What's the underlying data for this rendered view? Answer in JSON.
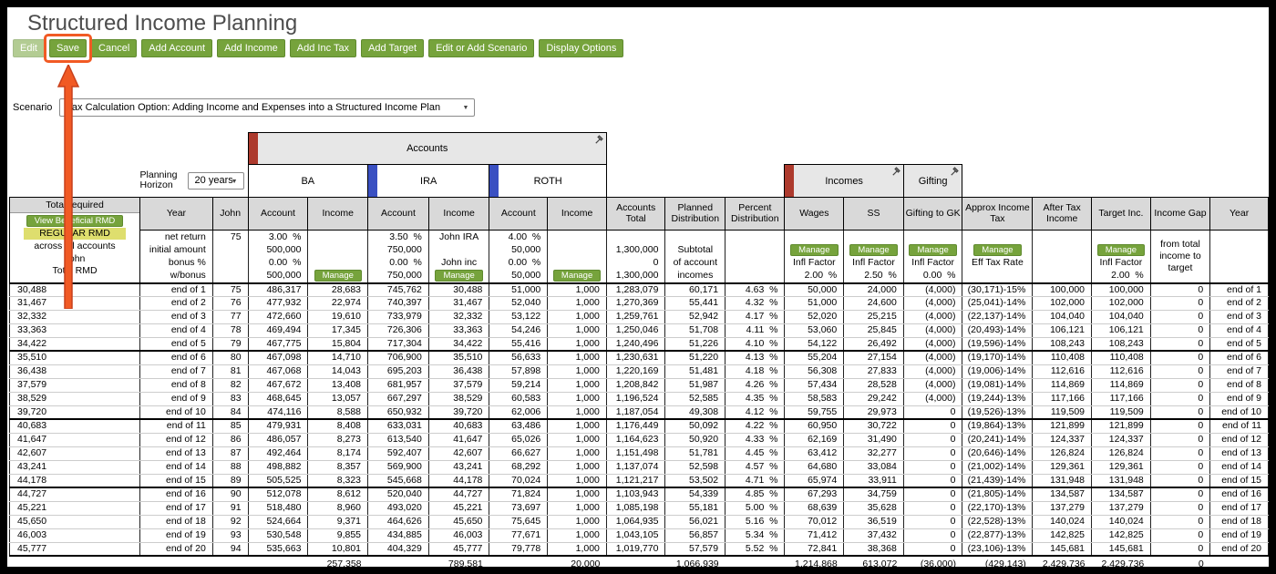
{
  "header": {
    "title": "Structured Income Planning",
    "toolbar": [
      {
        "id": "edit",
        "label": "Edit",
        "disabled": true
      },
      {
        "id": "save",
        "label": "Save",
        "annotated": true
      },
      {
        "id": "cancel",
        "label": "Cancel"
      },
      {
        "id": "add-account",
        "label": "Add Account"
      },
      {
        "id": "add-income",
        "label": "Add Income"
      },
      {
        "id": "add-inc-tax",
        "label": "Add Inc Tax"
      },
      {
        "id": "add-target",
        "label": "Add Target"
      },
      {
        "id": "edit-or-add-scenario",
        "label": "Edit or Add Scenario"
      },
      {
        "id": "display-options",
        "label": "Display Options"
      }
    ],
    "scenario_label": "Scenario",
    "scenario_value": "Tax Calculation Option: Adding Income and Expenses into a Structured Income Plan"
  },
  "icons": {
    "pin_icon": "pushpin",
    "dropdown_arrow_icon": "▼"
  },
  "colors": {
    "button_green": "#76a33c",
    "highlight_orange": "#f15a24",
    "header_gray": "#d9d9d9",
    "tab_red": "#ad3a2d",
    "tab_blue": "#3a50c2",
    "rmd_yellow": "#dede6e",
    "infl_peach": "#f5c48d"
  },
  "groups": {
    "accounts": "Accounts",
    "incomes": "Incomes",
    "gifting": "Gifting",
    "planning_horizon_label": "Planning Horizon",
    "planning_horizon_value": "20 years",
    "tabs": {
      "ba": "BA",
      "ira": "IRA",
      "roth": "ROTH"
    }
  },
  "left_panel": {
    "total_required": "Total required",
    "view_btn": "View Beneficial RMD",
    "regular_rmd": "REGULAR RMD",
    "across": "across all accounts",
    "owner": "John",
    "total_rmd": "Total RMD"
  },
  "table": {
    "headers": [
      "Year",
      "John",
      "Account",
      "Income",
      "Account",
      "Income",
      "Account",
      "Income",
      "Accounts Total",
      "Planned Distribution",
      "Percent Distribution",
      "Wages",
      "SS",
      "Gifting to GK",
      "Approx Income Tax",
      "After Tax Income",
      "Target Inc.",
      "Income Gap",
      "Year"
    ],
    "subrows": {
      "net_return_label": "net return",
      "start_age": "75",
      "ba_return": "3.00  %",
      "ira_return": "3.50  %",
      "ira_income_name": "John IRA",
      "roth_return": "4.00  %",
      "initial_label": "initial amount",
      "ba_initial": "500,000",
      "ira_initial": "750,000",
      "roth_initial": "50,000",
      "total_initial": "1,300,000",
      "subtotal_1": "Subtotal",
      "bonus_label": "bonus %",
      "ba_bonus": "0.00  %",
      "ira_bonus": "0.00  %",
      "ira_income_name2": "John inc",
      "roth_bonus": "0.00  %",
      "total_bonus": "0",
      "subtotal_2": "of account",
      "wbonus_label": "w/bonus",
      "ba_wbonus": "500,000",
      "ira_wbonus": "750,000",
      "roth_wbonus": "50,000",
      "total_wbonus": "1,300,000",
      "subtotal_3": "incomes",
      "manage_label": "Manage",
      "infl_label": "Infl Factor",
      "eff_label": "Eff Tax Rate",
      "wages_infl": "2.00  %",
      "ss_infl": "2.50  %",
      "gift_infl": "0.00  %",
      "target_infl": "2.00  %",
      "gap_note": "from total\nincome to\ntarget"
    },
    "rows": [
      [
        "30,488",
        "end of 1",
        "75",
        "486,317",
        "28,683",
        "745,762",
        "30,488",
        "51,000",
        "1,000",
        "1,283,079",
        "60,171",
        "4.63  %",
        "50,000",
        "24,000",
        "(4,000)",
        "(30,171)-15%",
        "100,000",
        "100,000",
        "0",
        "end of 1"
      ],
      [
        "31,467",
        "end of 2",
        "76",
        "477,932",
        "22,974",
        "740,397",
        "31,467",
        "52,040",
        "1,000",
        "1,270,369",
        "55,441",
        "4.32  %",
        "51,000",
        "24,600",
        "(4,000)",
        "(25,041)-14%",
        "102,000",
        "102,000",
        "0",
        "end of 2"
      ],
      [
        "32,332",
        "end of 3",
        "77",
        "472,660",
        "19,610",
        "733,979",
        "32,332",
        "53,122",
        "1,000",
        "1,259,761",
        "52,942",
        "4.17  %",
        "52,020",
        "25,215",
        "(4,000)",
        "(22,137)-14%",
        "104,040",
        "104,040",
        "0",
        "end of 3"
      ],
      [
        "33,363",
        "end of 4",
        "78",
        "469,494",
        "17,345",
        "726,306",
        "33,363",
        "54,246",
        "1,000",
        "1,250,046",
        "51,708",
        "4.11  %",
        "53,060",
        "25,845",
        "(4,000)",
        "(20,493)-14%",
        "106,121",
        "106,121",
        "0",
        "end of 4"
      ],
      [
        "34,422",
        "end of 5",
        "79",
        "467,775",
        "15,804",
        "717,304",
        "34,422",
        "55,416",
        "1,000",
        "1,240,496",
        "51,226",
        "4.10  %",
        "54,122",
        "26,492",
        "(4,000)",
        "(19,596)-14%",
        "108,243",
        "108,243",
        "0",
        "end of 5"
      ],
      [
        "35,510",
        "end of 6",
        "80",
        "467,098",
        "14,710",
        "706,900",
        "35,510",
        "56,633",
        "1,000",
        "1,230,631",
        "51,220",
        "4.13  %",
        "55,204",
        "27,154",
        "(4,000)",
        "(19,170)-14%",
        "110,408",
        "110,408",
        "0",
        "end of 6"
      ],
      [
        "36,438",
        "end of 7",
        "81",
        "467,068",
        "14,043",
        "695,203",
        "36,438",
        "57,898",
        "1,000",
        "1,220,169",
        "51,481",
        "4.18  %",
        "56,308",
        "27,833",
        "(4,000)",
        "(19,006)-14%",
        "112,616",
        "112,616",
        "0",
        "end of 7"
      ],
      [
        "37,579",
        "end of 8",
        "82",
        "467,672",
        "13,408",
        "681,957",
        "37,579",
        "59,214",
        "1,000",
        "1,208,842",
        "51,987",
        "4.26  %",
        "57,434",
        "28,528",
        "(4,000)",
        "(19,081)-14%",
        "114,869",
        "114,869",
        "0",
        "end of 8"
      ],
      [
        "38,529",
        "end of 9",
        "83",
        "468,645",
        "13,057",
        "667,297",
        "38,529",
        "60,583",
        "1,000",
        "1,196,524",
        "52,585",
        "4.35  %",
        "58,583",
        "29,242",
        "(4,000)",
        "(19,244)-13%",
        "117,166",
        "117,166",
        "0",
        "end of 9"
      ],
      [
        "39,720",
        "end of 10",
        "84",
        "474,116",
        "8,588",
        "650,932",
        "39,720",
        "62,006",
        "1,000",
        "1,187,054",
        "49,308",
        "4.12  %",
        "59,755",
        "29,973",
        "0",
        "(19,526)-13%",
        "119,509",
        "119,509",
        "0",
        "end of 10"
      ],
      [
        "40,683",
        "end of 11",
        "85",
        "479,931",
        "8,408",
        "633,031",
        "40,683",
        "63,486",
        "1,000",
        "1,176,449",
        "50,092",
        "4.22  %",
        "60,950",
        "30,722",
        "0",
        "(19,864)-13%",
        "121,899",
        "121,899",
        "0",
        "end of 11"
      ],
      [
        "41,647",
        "end of 12",
        "86",
        "486,057",
        "8,273",
        "613,540",
        "41,647",
        "65,026",
        "1,000",
        "1,164,623",
        "50,920",
        "4.33  %",
        "62,169",
        "31,490",
        "0",
        "(20,241)-14%",
        "124,337",
        "124,337",
        "0",
        "end of 12"
      ],
      [
        "42,607",
        "end of 13",
        "87",
        "492,464",
        "8,174",
        "592,407",
        "42,607",
        "66,627",
        "1,000",
        "1,151,498",
        "51,781",
        "4.45  %",
        "63,412",
        "32,277",
        "0",
        "(20,646)-14%",
        "126,824",
        "126,824",
        "0",
        "end of 13"
      ],
      [
        "43,241",
        "end of 14",
        "88",
        "498,882",
        "8,357",
        "569,900",
        "43,241",
        "68,292",
        "1,000",
        "1,137,074",
        "52,598",
        "4.57  %",
        "64,680",
        "33,084",
        "0",
        "(21,002)-14%",
        "129,361",
        "129,361",
        "0",
        "end of 14"
      ],
      [
        "44,178",
        "end of 15",
        "89",
        "505,525",
        "8,323",
        "545,668",
        "44,178",
        "70,024",
        "1,000",
        "1,121,217",
        "53,502",
        "4.71  %",
        "65,974",
        "33,911",
        "0",
        "(21,439)-14%",
        "131,948",
        "131,948",
        "0",
        "end of 15"
      ],
      [
        "44,727",
        "end of 16",
        "90",
        "512,078",
        "8,612",
        "520,040",
        "44,727",
        "71,824",
        "1,000",
        "1,103,943",
        "54,339",
        "4.85  %",
        "67,293",
        "34,759",
        "0",
        "(21,805)-14%",
        "134,587",
        "134,587",
        "0",
        "end of 16"
      ],
      [
        "45,221",
        "end of 17",
        "91",
        "518,480",
        "8,960",
        "493,020",
        "45,221",
        "73,697",
        "1,000",
        "1,085,198",
        "55,181",
        "5.00  %",
        "68,639",
        "35,628",
        "0",
        "(22,170)-13%",
        "137,279",
        "137,279",
        "0",
        "end of 17"
      ],
      [
        "45,650",
        "end of 18",
        "92",
        "524,664",
        "9,371",
        "464,626",
        "45,650",
        "75,645",
        "1,000",
        "1,064,935",
        "56,021",
        "5.16  %",
        "70,012",
        "36,519",
        "0",
        "(22,528)-13%",
        "140,024",
        "140,024",
        "0",
        "end of 18"
      ],
      [
        "46,003",
        "end of 19",
        "93",
        "530,548",
        "9,855",
        "434,885",
        "46,003",
        "77,671",
        "1,000",
        "1,043,105",
        "56,857",
        "5.34  %",
        "71,412",
        "37,432",
        "0",
        "(22,877)-13%",
        "142,825",
        "142,825",
        "0",
        "end of 19"
      ],
      [
        "45,777",
        "end of 20",
        "94",
        "535,663",
        "10,801",
        "404,329",
        "45,777",
        "79,778",
        "1,000",
        "1,019,770",
        "57,579",
        "5.52  %",
        "72,841",
        "38,368",
        "0",
        "(23,106)-13%",
        "145,681",
        "145,681",
        "0",
        "end of 20"
      ]
    ],
    "totals": [
      "",
      "",
      "",
      "",
      "257,358",
      "",
      "789,581",
      "",
      "20,000",
      "",
      "1,066,939",
      "",
      "1,214,868",
      "613,072",
      "(36,000)",
      "(429,143)",
      "2,429,736",
      "2,429,736",
      "0",
      ""
    ]
  }
}
